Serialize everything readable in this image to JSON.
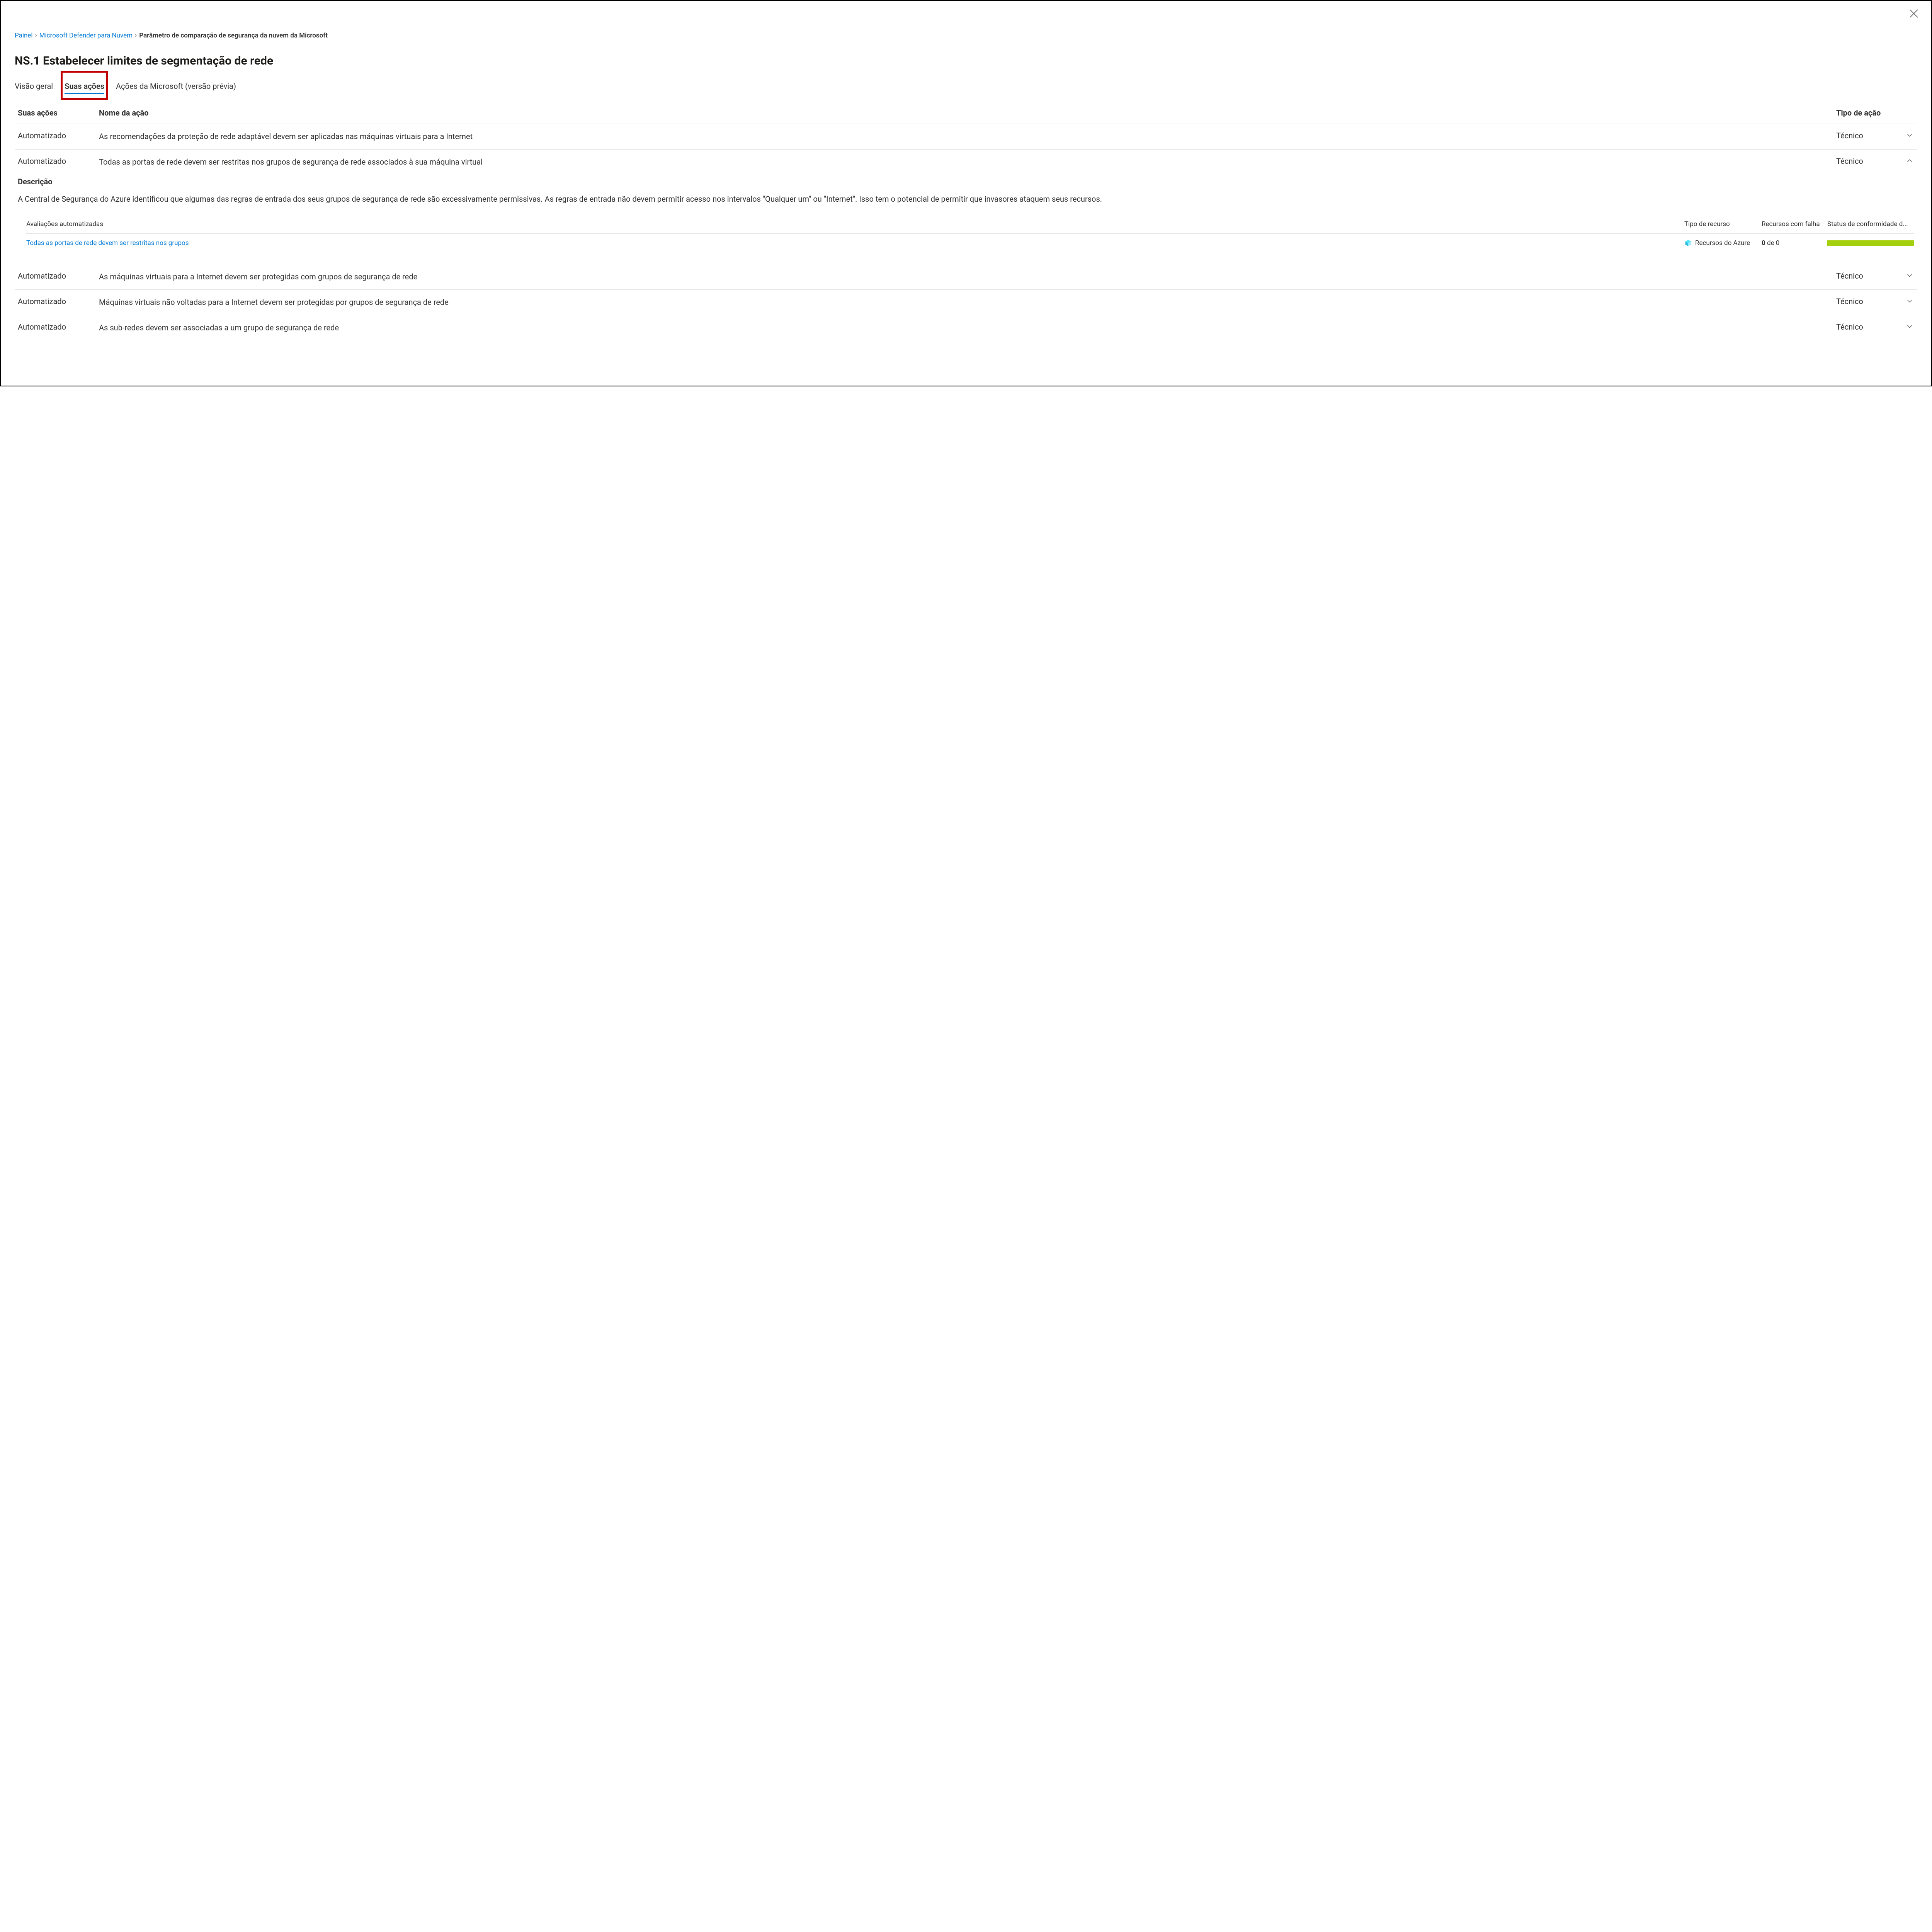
{
  "breadcrumb": {
    "item1": "Painel",
    "item2": "Microsoft Defender para Nuvem",
    "current": "Parâmetro de comparação de segurança da nuvem da Microsoft"
  },
  "page_title": "NS.1 Estabelecer limites de segmentação de rede",
  "tabs": {
    "overview": "Visão geral",
    "your_actions": "Suas ações",
    "ms_actions": "Ações da Microsoft (versão prévia)"
  },
  "columns": {
    "actions": "Suas ações",
    "name": "Nome da ação",
    "type": "Tipo de ação"
  },
  "rows": [
    {
      "actions": "Automatizado",
      "name": "As recomendações da proteção de rede adaptável devem ser aplicadas nas máquinas virtuais para a Internet",
      "type": "Técnico",
      "expanded": false
    },
    {
      "actions": "Automatizado",
      "name": "Todas as portas de rede devem ser restritas nos grupos de segurança de rede associados à sua máquina virtual",
      "type": "Técnico",
      "expanded": true
    },
    {
      "actions": "Automatizado",
      "name": "As máquinas virtuais para a Internet devem ser protegidas com grupos de segurança de rede",
      "type": "Técnico",
      "expanded": false
    },
    {
      "actions": "Automatizado",
      "name": "Máquinas virtuais não voltadas para a Internet devem ser protegidas por grupos de segurança de rede",
      "type": "Técnico",
      "expanded": false
    },
    {
      "actions": "Automatizado",
      "name": "As sub-redes devem ser associadas a um grupo de segurança de rede",
      "type": "Técnico",
      "expanded": false
    }
  ],
  "detail": {
    "heading": "Descrição",
    "text": "A Central de Segurança do Azure identificou que algumas das regras de entrada dos seus grupos de segurança de rede são excessivamente permissivas. As regras de entrada não devem permitir acesso nos intervalos \"Qualquer um\" ou \"Internet\". Isso tem o potencial de permitir que invasores ataquem seus recursos."
  },
  "assessments": {
    "headers": {
      "c1": "Avaliações automatizadas",
      "c2": "Tipo de recurso",
      "c3": "Recursos com falha",
      "c4": "Status de conformidade d..."
    },
    "row": {
      "c1": "Todas as portas de rede devem ser restritas nos grupos",
      "c2": "Recursos do Azure",
      "c3_bold": "0",
      "c3_rest": " de 0"
    }
  }
}
